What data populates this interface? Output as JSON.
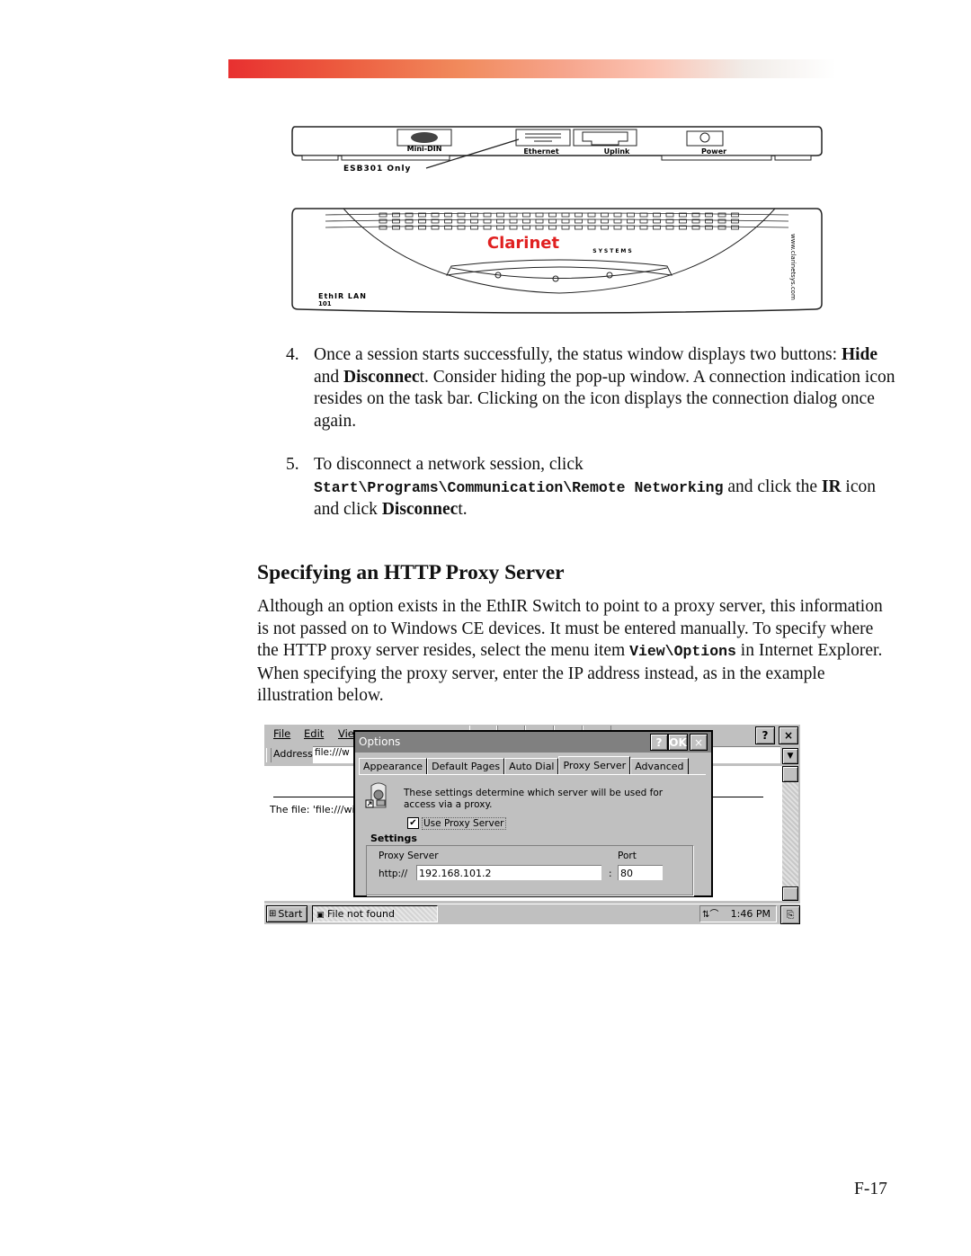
{
  "header": {
    "bar_gradient": [
      "#e83030",
      "#f18a5c",
      "#fbc4b4",
      "#ffffff"
    ]
  },
  "device_side_view": {
    "port_labels": [
      "Mini-DIN",
      "Ethernet",
      "Uplink",
      "Power"
    ],
    "callout": "ESB301 Only"
  },
  "device_top_view": {
    "brand": "Clarinet",
    "brand_sub": "SYSTEMS",
    "model_line1": "EthIR LAN",
    "model_line2": "101",
    "side_url": "www.clarinetsys.com",
    "brand_color": "#e02020"
  },
  "steps": [
    {
      "number": "4.",
      "parts": [
        {
          "text": "Once a session starts successfully, the status window displays two buttons: "
        },
        {
          "text": "Hide",
          "bold": true
        },
        {
          "text": " and "
        },
        {
          "text": "Disconnec",
          "bold": true
        },
        {
          "text": "t.  Consider hiding the pop-up window.  A connection indication icon resides on the task bar.  Clicking on the icon displays the connection dialog once again."
        }
      ]
    },
    {
      "number": "5.",
      "parts": [
        {
          "text": "To disconnect a network session, click "
        },
        {
          "text": "Start\\Programs\\Communication\\Remote Networking",
          "mono": true
        },
        {
          "text": " and click the "
        },
        {
          "text": "IR",
          "bold": true
        },
        {
          "text": " icon and click "
        },
        {
          "text": "Disconnec",
          "bold": true
        },
        {
          "text": "t."
        }
      ]
    }
  ],
  "section": {
    "heading": "Specifying an HTTP Proxy Server",
    "paragraph_parts": [
      {
        "text": "Although an option exists in the EthIR Switch to point to a proxy server, this information is not passed on to Windows CE devices.  It must be entered manually.  To specify where the HTTP proxy server resides, select the menu item "
      },
      {
        "text": "View\\Options",
        "mono": true
      },
      {
        "text": " in Internet Explorer.  When specifying the proxy server, enter the IP address instead, as in the example illustration below."
      }
    ]
  },
  "ce_screenshot": {
    "menu": [
      "File",
      "Edit",
      "Vie"
    ],
    "help_button": "?",
    "close_button": "×",
    "address_label": "Address",
    "address_value": "file:///w",
    "content_text": "The file: 'file:///winc",
    "dialog": {
      "title": "Options",
      "help_button": "?",
      "ok_button": "OK",
      "close_button": "×",
      "tabs": [
        "Appearance",
        "Default Pages",
        "Auto Dial",
        "Proxy Server",
        "Advanced"
      ],
      "active_tab": "Proxy Server",
      "description": "These settings determine which server will be used for access via a proxy.",
      "use_proxy_label": "Use Proxy Server",
      "use_proxy_checked": true,
      "settings_group": "Settings",
      "proxy_server_label": "Proxy Server",
      "port_label": "Port",
      "scheme_prefix": "http://",
      "proxy_server_value": "192.168.101.2",
      "separator": ":",
      "port_value": "80"
    },
    "taskbar": {
      "start_label": "Start",
      "task_label": "File not found",
      "clock": "1:46 PM"
    }
  },
  "footer": {
    "page_number": "F-17"
  }
}
